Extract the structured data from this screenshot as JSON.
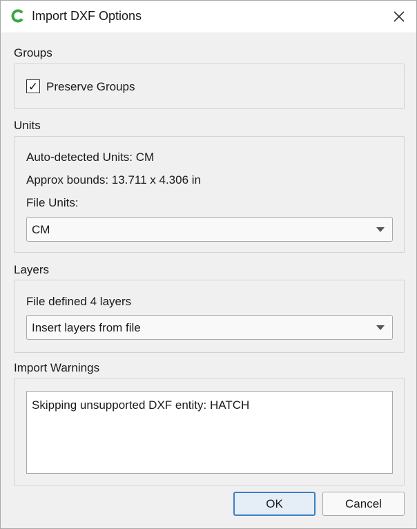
{
  "window": {
    "title": "Import DXF Options",
    "accent_color": "#3c7fc4",
    "app_icon_color": "#3aa745"
  },
  "groups": {
    "title": "Groups",
    "preserve_groups_label": "Preserve Groups",
    "preserve_groups_checked": true,
    "check_glyph": "✓"
  },
  "units": {
    "title": "Units",
    "auto_detected": "Auto-detected Units: CM",
    "approx_bounds": "Approx bounds: 13.711 x 4.306 in",
    "file_units_label": "File Units:",
    "file_units_value": "CM"
  },
  "layers": {
    "title": "Layers",
    "file_defined": "File defined 4 layers",
    "layer_mode_value": "Insert layers from file"
  },
  "warnings": {
    "title": "Import Warnings",
    "text": "Skipping unsupported DXF entity: HATCH"
  },
  "buttons": {
    "ok_label": "OK",
    "cancel_label": "Cancel"
  }
}
